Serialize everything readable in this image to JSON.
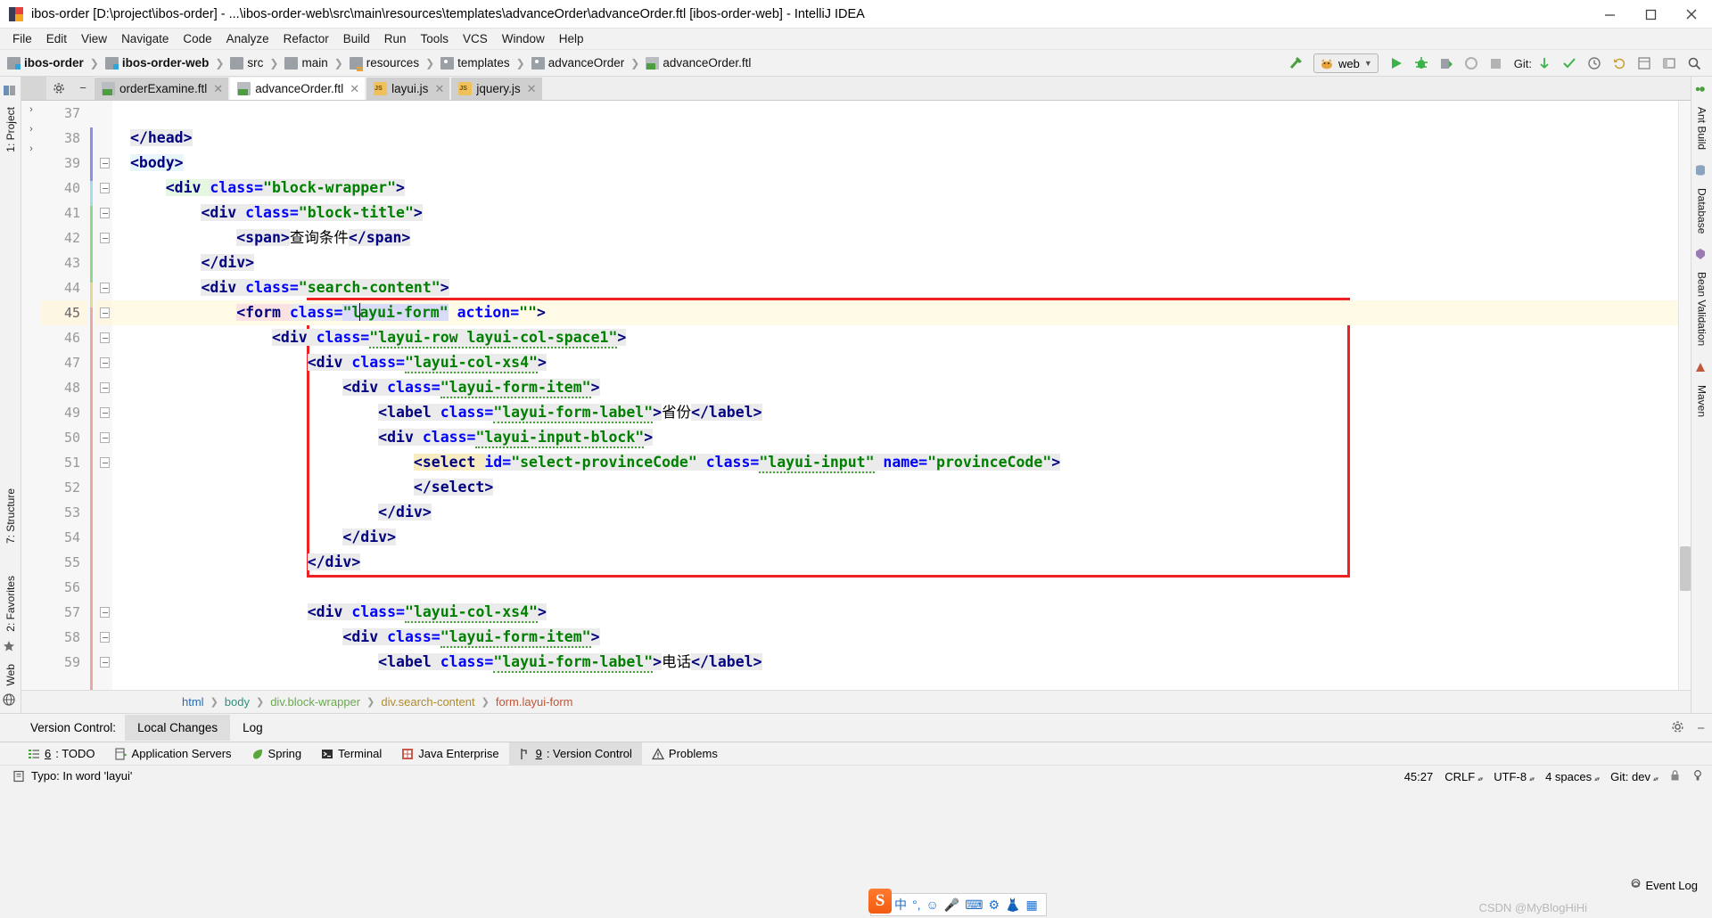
{
  "window": {
    "title": "ibos-order [D:\\project\\ibos-order] - ...\\ibos-order-web\\src\\main\\resources\\templates\\advanceOrder\\advanceOrder.ftl [ibos-order-web] - IntelliJ IDEA",
    "minimize": "minimize-icon",
    "maximize": "maximize-icon",
    "close": "close-icon"
  },
  "menu": {
    "items": [
      "File",
      "Edit",
      "View",
      "Navigate",
      "Code",
      "Analyze",
      "Refactor",
      "Build",
      "Run",
      "Tools",
      "VCS",
      "Window",
      "Help"
    ]
  },
  "navbar": {
    "crumbs": [
      {
        "label": "ibos-order",
        "icon": "module-icon",
        "bold": true
      },
      {
        "label": "ibos-order-web",
        "icon": "module-icon",
        "bold": true
      },
      {
        "label": "src",
        "icon": "folder-icon",
        "bold": false
      },
      {
        "label": "main",
        "icon": "folder-icon",
        "bold": false
      },
      {
        "label": "resources",
        "icon": "resources-folder-icon",
        "bold": false
      },
      {
        "label": "templates",
        "icon": "folder-icon",
        "bold": false
      },
      {
        "label": "advanceOrder",
        "icon": "folder-icon",
        "bold": false
      },
      {
        "label": "advanceOrder.ftl",
        "icon": "ftl-file-icon",
        "bold": false
      }
    ],
    "run_config": "web",
    "git_label": "Git:"
  },
  "tabs": [
    {
      "label": "orderExamine.ftl",
      "type": "ftl",
      "active": false
    },
    {
      "label": "advanceOrder.ftl",
      "type": "ftl",
      "active": true
    },
    {
      "label": "layui.js",
      "type": "js",
      "active": false
    },
    {
      "label": "jquery.js",
      "type": "js",
      "active": false
    }
  ],
  "left_tool_strip": {
    "top_labels": [
      "1: Project"
    ],
    "mid_labels": [
      "7: Structure"
    ],
    "bottom_labels": [
      "2: Favorites",
      "Web"
    ]
  },
  "right_tool_strip": {
    "labels": [
      "Ant Build",
      "Database",
      "Bean Validation",
      "Maven"
    ]
  },
  "editor": {
    "first_line_number": 37,
    "caret_line": 45,
    "lines": [
      {
        "n": 37,
        "indent": 0,
        "tokens": []
      },
      {
        "n": 38,
        "indent": 0,
        "tokens": [
          {
            "t": "</head>",
            "c": "tag",
            "hl": "grey"
          }
        ]
      },
      {
        "n": 39,
        "indent": 0,
        "tokens": [
          {
            "t": "<body>",
            "c": "tag",
            "hl": "cyan"
          }
        ]
      },
      {
        "n": 40,
        "indent": 4,
        "tokens": [
          {
            "t": "<div ",
            "c": "tag",
            "hl": "green"
          },
          {
            "t": "class=",
            "c": "attr",
            "hl": "grey"
          },
          {
            "t": "\"block-wrapper\"",
            "c": "val",
            "hl": "grey"
          },
          {
            "t": ">",
            "c": "tag",
            "hl": "grey"
          }
        ]
      },
      {
        "n": 41,
        "indent": 8,
        "tokens": [
          {
            "t": "<div ",
            "c": "tag",
            "hl": "grey"
          },
          {
            "t": "class=",
            "c": "attr",
            "hl": "grey"
          },
          {
            "t": "\"block-title\"",
            "c": "val",
            "hl": "grey"
          },
          {
            "t": ">",
            "c": "tag",
            "hl": "grey"
          }
        ]
      },
      {
        "n": 42,
        "indent": 12,
        "tokens": [
          {
            "t": "<span>",
            "c": "tag",
            "hl": "grey"
          },
          {
            "t": "查询条件",
            "c": "text",
            "hl": "none"
          },
          {
            "t": "</span>",
            "c": "tag",
            "hl": "grey"
          }
        ]
      },
      {
        "n": 43,
        "indent": 8,
        "tokens": [
          {
            "t": "</div>",
            "c": "tag",
            "hl": "grey"
          }
        ]
      },
      {
        "n": 44,
        "indent": 8,
        "tokens": [
          {
            "t": "<div ",
            "c": "tag",
            "hl": "grey"
          },
          {
            "t": "class=",
            "c": "attr",
            "hl": "grey"
          },
          {
            "t": "\"search-content\"",
            "c": "val",
            "hl": "grey"
          },
          {
            "t": ">",
            "c": "tag",
            "hl": "grey"
          }
        ]
      },
      {
        "n": 45,
        "indent": 12,
        "tokens": [
          {
            "t": "<form ",
            "c": "tag",
            "hl": "pink"
          },
          {
            "t": "class=",
            "c": "attr",
            "hl": "grey"
          },
          {
            "t": "\"layui-form\"",
            "c": "val",
            "hl": "blue",
            "caret_after": 2
          },
          {
            "t": " action=",
            "c": "attr",
            "hl": "none"
          },
          {
            "t": "\"\"",
            "c": "val",
            "hl": "none"
          },
          {
            "t": ">",
            "c": "tag",
            "hl": "none"
          }
        ]
      },
      {
        "n": 46,
        "indent": 16,
        "tokens": [
          {
            "t": "<div ",
            "c": "tag",
            "hl": "grey"
          },
          {
            "t": "class=",
            "c": "attr",
            "hl": "grey"
          },
          {
            "t": "\"layui-row layui-col-space1\"",
            "c": "val",
            "hl": "grey",
            "squiggle": true
          },
          {
            "t": ">",
            "c": "tag",
            "hl": "grey"
          }
        ]
      },
      {
        "n": 47,
        "indent": 20,
        "tokens": [
          {
            "t": "<div ",
            "c": "tag",
            "hl": "grey"
          },
          {
            "t": "class=",
            "c": "attr",
            "hl": "grey"
          },
          {
            "t": "\"layui-col-xs4\"",
            "c": "val",
            "hl": "grey",
            "squiggle": true
          },
          {
            "t": ">",
            "c": "tag",
            "hl": "grey"
          }
        ]
      },
      {
        "n": 48,
        "indent": 24,
        "tokens": [
          {
            "t": "<div ",
            "c": "tag",
            "hl": "grey"
          },
          {
            "t": "class=",
            "c": "attr",
            "hl": "grey"
          },
          {
            "t": "\"layui-form-item\"",
            "c": "val",
            "hl": "grey",
            "squiggle": true
          },
          {
            "t": ">",
            "c": "tag",
            "hl": "grey"
          }
        ]
      },
      {
        "n": 49,
        "indent": 28,
        "tokens": [
          {
            "t": "<label ",
            "c": "tag",
            "hl": "grey"
          },
          {
            "t": "class=",
            "c": "attr",
            "hl": "grey"
          },
          {
            "t": "\"layui-form-label\"",
            "c": "val",
            "hl": "grey",
            "squiggle": true
          },
          {
            "t": ">",
            "c": "tag",
            "hl": "grey"
          },
          {
            "t": "省份",
            "c": "text",
            "hl": "none"
          },
          {
            "t": "</label>",
            "c": "tag",
            "hl": "grey"
          }
        ]
      },
      {
        "n": 50,
        "indent": 28,
        "tokens": [
          {
            "t": "<div ",
            "c": "tag",
            "hl": "grey"
          },
          {
            "t": "class=",
            "c": "attr",
            "hl": "grey"
          },
          {
            "t": "\"layui-input-block\"",
            "c": "val",
            "hl": "grey",
            "squiggle": true
          },
          {
            "t": ">",
            "c": "tag",
            "hl": "grey"
          }
        ]
      },
      {
        "n": 51,
        "indent": 32,
        "tokens": [
          {
            "t": "<select ",
            "c": "tag",
            "hl": "yellow"
          },
          {
            "t": "id=",
            "c": "attr",
            "hl": "grey"
          },
          {
            "t": "\"select-provinceCode\"",
            "c": "val",
            "hl": "grey"
          },
          {
            "t": " class=",
            "c": "attr",
            "hl": "grey"
          },
          {
            "t": "\"layui-input\"",
            "c": "val",
            "hl": "grey",
            "squiggle": true
          },
          {
            "t": " name=",
            "c": "attr",
            "hl": "grey"
          },
          {
            "t": "\"provinceCode\"",
            "c": "val",
            "hl": "grey"
          },
          {
            "t": ">",
            "c": "tag",
            "hl": "grey"
          }
        ]
      },
      {
        "n": 52,
        "indent": 32,
        "tokens": [
          {
            "t": "</select>",
            "c": "tag",
            "hl": "grey"
          }
        ]
      },
      {
        "n": 53,
        "indent": 28,
        "tokens": [
          {
            "t": "</div>",
            "c": "tag",
            "hl": "grey"
          }
        ]
      },
      {
        "n": 54,
        "indent": 24,
        "tokens": [
          {
            "t": "</div>",
            "c": "tag",
            "hl": "grey"
          }
        ]
      },
      {
        "n": 55,
        "indent": 20,
        "tokens": [
          {
            "t": "</div>",
            "c": "tag",
            "hl": "grey"
          }
        ]
      },
      {
        "n": 56,
        "indent": 0,
        "tokens": []
      },
      {
        "n": 57,
        "indent": 20,
        "tokens": [
          {
            "t": "<div ",
            "c": "tag",
            "hl": "grey"
          },
          {
            "t": "class=",
            "c": "attr",
            "hl": "grey"
          },
          {
            "t": "\"layui-col-xs4\"",
            "c": "val",
            "hl": "grey",
            "squiggle": true
          },
          {
            "t": ">",
            "c": "tag",
            "hl": "grey"
          }
        ]
      },
      {
        "n": 58,
        "indent": 24,
        "tokens": [
          {
            "t": "<div ",
            "c": "tag",
            "hl": "grey"
          },
          {
            "t": "class=",
            "c": "attr",
            "hl": "grey"
          },
          {
            "t": "\"layui-form-item\"",
            "c": "val",
            "hl": "grey",
            "squiggle": true
          },
          {
            "t": ">",
            "c": "tag",
            "hl": "grey"
          }
        ]
      },
      {
        "n": 59,
        "indent": 28,
        "tokens": [
          {
            "t": "<label ",
            "c": "tag",
            "hl": "grey"
          },
          {
            "t": "class=",
            "c": "attr",
            "hl": "grey"
          },
          {
            "t": "\"layui-form-label\"",
            "c": "val",
            "hl": "grey",
            "squiggle": true
          },
          {
            "t": ">",
            "c": "tag",
            "hl": "grey"
          },
          {
            "t": "电话",
            "c": "text",
            "hl": "none"
          },
          {
            "t": "</label>",
            "c": "tag",
            "hl": "grey"
          }
        ]
      }
    ],
    "annotation_color": "#ee2222"
  },
  "editor_breadcrumb": [
    {
      "label": "html",
      "color": "#2b6cb0"
    },
    {
      "label": "body",
      "color": "#2f8f7f"
    },
    {
      "label": "div.block-wrapper",
      "color": "#6aa84f"
    },
    {
      "label": "div.search-content",
      "color": "#b08b2e"
    },
    {
      "label": "form.layui-form",
      "color": "#c0563a"
    }
  ],
  "version_control": {
    "label": "Version Control:",
    "tabs": [
      {
        "label": "Local Changes",
        "active": true
      },
      {
        "label": "Log",
        "active": false
      }
    ],
    "gear": "gear-icon",
    "minimize": "minimize-icon"
  },
  "bottom_bar": {
    "items": [
      {
        "num": "6",
        "label": ": TODO",
        "icon": "todo-icon",
        "active": false
      },
      {
        "num": "",
        "label": "Application Servers",
        "icon": "server-icon",
        "active": false
      },
      {
        "num": "",
        "label": "Spring",
        "icon": "spring-leaf-icon",
        "active": false
      },
      {
        "num": "",
        "label": "Terminal",
        "icon": "terminal-icon",
        "active": false
      },
      {
        "num": "",
        "label": "Java Enterprise",
        "icon": "java-enterprise-icon",
        "active": false
      },
      {
        "num": "9",
        "label": ": Version Control",
        "icon": "branch-icon",
        "active": true
      },
      {
        "num": "",
        "label": "Problems",
        "icon": "warning-triangle-icon",
        "active": false
      }
    ]
  },
  "status_bar": {
    "message": "Typo: In word 'layui'",
    "message_icon": "inspection-icon",
    "event_log": "Event Log",
    "event_log_icon": "bell-icon",
    "caret_position": "45:27",
    "line_separator": "CRLF",
    "encoding": "UTF-8",
    "indent": "4 spaces",
    "git_branch": "Git: dev",
    "lock_icon": "lock-icon",
    "inspection_icon": "inspections-icon"
  },
  "ime": {
    "logo": "S",
    "items": [
      "中",
      "°,",
      "☺",
      "mic-icon",
      "keyboard-icon",
      "tools-icon",
      "skin-icon",
      "apps-icon"
    ]
  },
  "watermark": "CSDN @MyBlogHiHi",
  "colors": {
    "accent_red": "#ee2222",
    "caret_line_bg": "#fffae6",
    "tag": "#000080",
    "attr": "#0000ff",
    "value": "#008000"
  }
}
